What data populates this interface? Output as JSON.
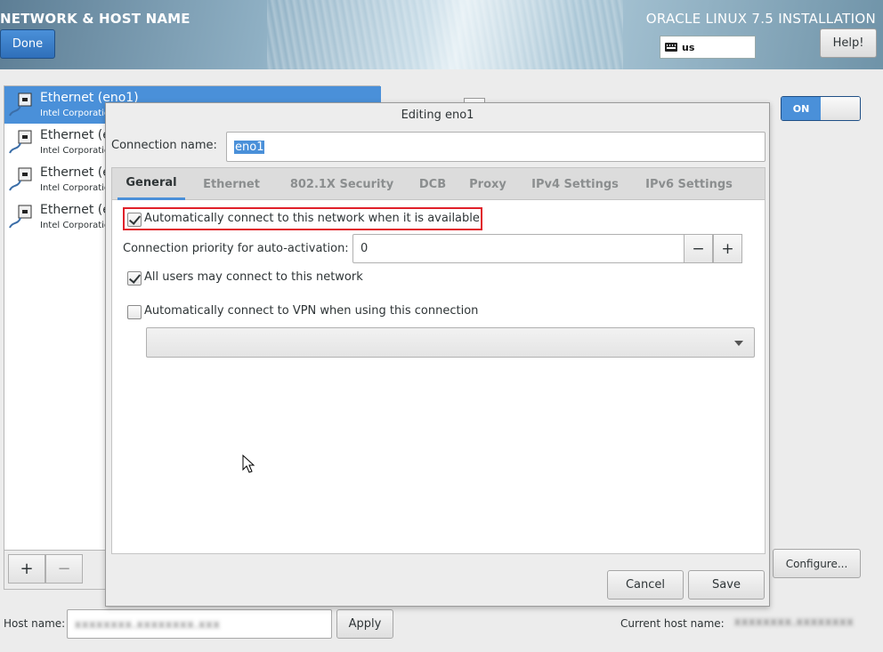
{
  "header": {
    "screen_title": "NETWORK & HOST NAME",
    "product_title": "ORACLE LINUX 7.5 INSTALLATION",
    "done_label": "Done",
    "keyboard_layout": "us",
    "help_label": "Help!"
  },
  "devices": [
    {
      "name": "Ethernet (eno1)",
      "subtitle": "Intel Corporation",
      "selected": true
    },
    {
      "name": "Ethernet (e",
      "subtitle": "Intel Corporation",
      "selected": false
    },
    {
      "name": "Ethernet (e",
      "subtitle": "Intel Corporation",
      "selected": false
    },
    {
      "name": "Ethernet (e",
      "subtitle": "Intel Corporation",
      "selected": false
    }
  ],
  "list_tools": {
    "add": "+",
    "remove": "−"
  },
  "toggle": {
    "on_label": "ON",
    "state": "on"
  },
  "configure_label": "Configure...",
  "hostname": {
    "label": "Host name:",
    "value": "",
    "apply_label": "Apply",
    "current_label": "Current host name:",
    "current_value": ""
  },
  "dialog": {
    "title": "Editing eno1",
    "connection_name_label": "Connection name:",
    "connection_name_value": "eno1",
    "tabs": [
      "General",
      "Ethernet",
      "802.1X Security",
      "DCB",
      "Proxy",
      "IPv4 Settings",
      "IPv6 Settings"
    ],
    "active_tab": "General",
    "general": {
      "auto_connect_label": "Automatically connect to this network when it is available",
      "auto_connect_checked": true,
      "priority_label": "Connection priority for auto-activation:",
      "priority_value": "0",
      "minus": "−",
      "plus": "+",
      "all_users_label": "All users may connect to this network",
      "all_users_checked": true,
      "vpn_label": "Automatically connect to VPN when using this connection",
      "vpn_checked": false,
      "vpn_selected": ""
    },
    "cancel_label": "Cancel",
    "save_label": "Save"
  },
  "colors": {
    "accent": "#4a90d9",
    "highlight": "#e0202a"
  }
}
